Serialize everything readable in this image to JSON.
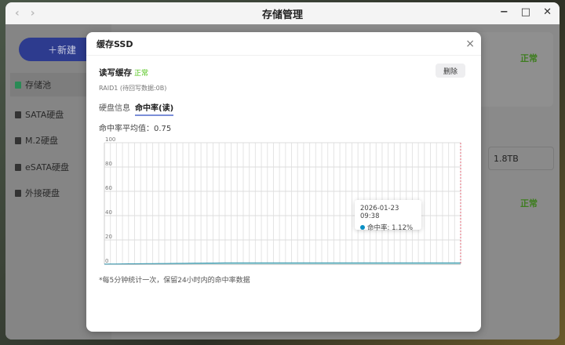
{
  "window": {
    "title": "存储管理",
    "back": "‹",
    "forward": "›",
    "minimize": "−",
    "maximize": "□",
    "close": "✕"
  },
  "sidebar": {
    "new_button": "＋新建",
    "items": [
      {
        "label": "存储池"
      },
      {
        "label": "SATA硬盘"
      },
      {
        "label": "M.2硬盘"
      },
      {
        "label": "eSATA硬盘"
      },
      {
        "label": "外接硬盘"
      }
    ]
  },
  "background": {
    "status1": "正常",
    "status2": "正常",
    "capacity": "1.8TB"
  },
  "modal": {
    "title": "缓存SSD",
    "close": "×",
    "cache_title": "读写缓存",
    "cache_status": "正常",
    "delete_button": "删除",
    "raid_info": "RAID1 (待回写数据:0B)",
    "tabs": [
      "硬盘信息",
      "命中率(读)"
    ],
    "average": "命中率平均值：0.75",
    "note": "*每5分钟统计一次，保留24小时内的命中率数据",
    "tooltip": {
      "time": "2026-01-23 09:38",
      "label": "命中率: 1.12%"
    }
  },
  "colors": {
    "line": "#2a8fa8",
    "area": "#a8d8dc",
    "marker": "#e06070",
    "accent": "#2d3b8e",
    "ok": "#52c41a"
  },
  "chart_data": {
    "type": "area",
    "title": "",
    "xlabel": "",
    "ylabel": "",
    "ylim": [
      0,
      100
    ],
    "yticks": [
      0,
      20,
      40,
      60,
      80,
      100
    ],
    "grid": true,
    "series": [
      {
        "name": "命中率",
        "values": [
          0.1,
          0.15,
          0.2,
          0.25,
          0.3,
          0.35,
          0.4,
          0.45,
          0.5,
          0.55,
          0.6,
          0.65,
          0.7,
          0.75,
          0.8,
          0.85,
          0.9,
          0.95,
          1.0,
          1.05,
          1.1,
          1.12,
          1.12,
          1.12,
          1.12,
          1.12,
          1.12,
          1.12,
          1.12,
          1.12,
          1.12,
          1.12,
          1.12,
          1.12,
          1.12,
          1.12,
          1.12,
          1.12,
          1.12,
          1.12,
          1.12,
          1.12,
          1.12,
          1.12,
          1.12,
          1.12,
          1.12,
          1.12,
          1.12,
          1.12,
          1.12,
          1.12,
          1.12,
          1.12,
          1.12,
          1.12,
          1.12,
          1.12,
          1.12,
          1.12
        ]
      }
    ],
    "highlight": {
      "time": "2026-01-23 09:38",
      "value": 1.12
    }
  }
}
